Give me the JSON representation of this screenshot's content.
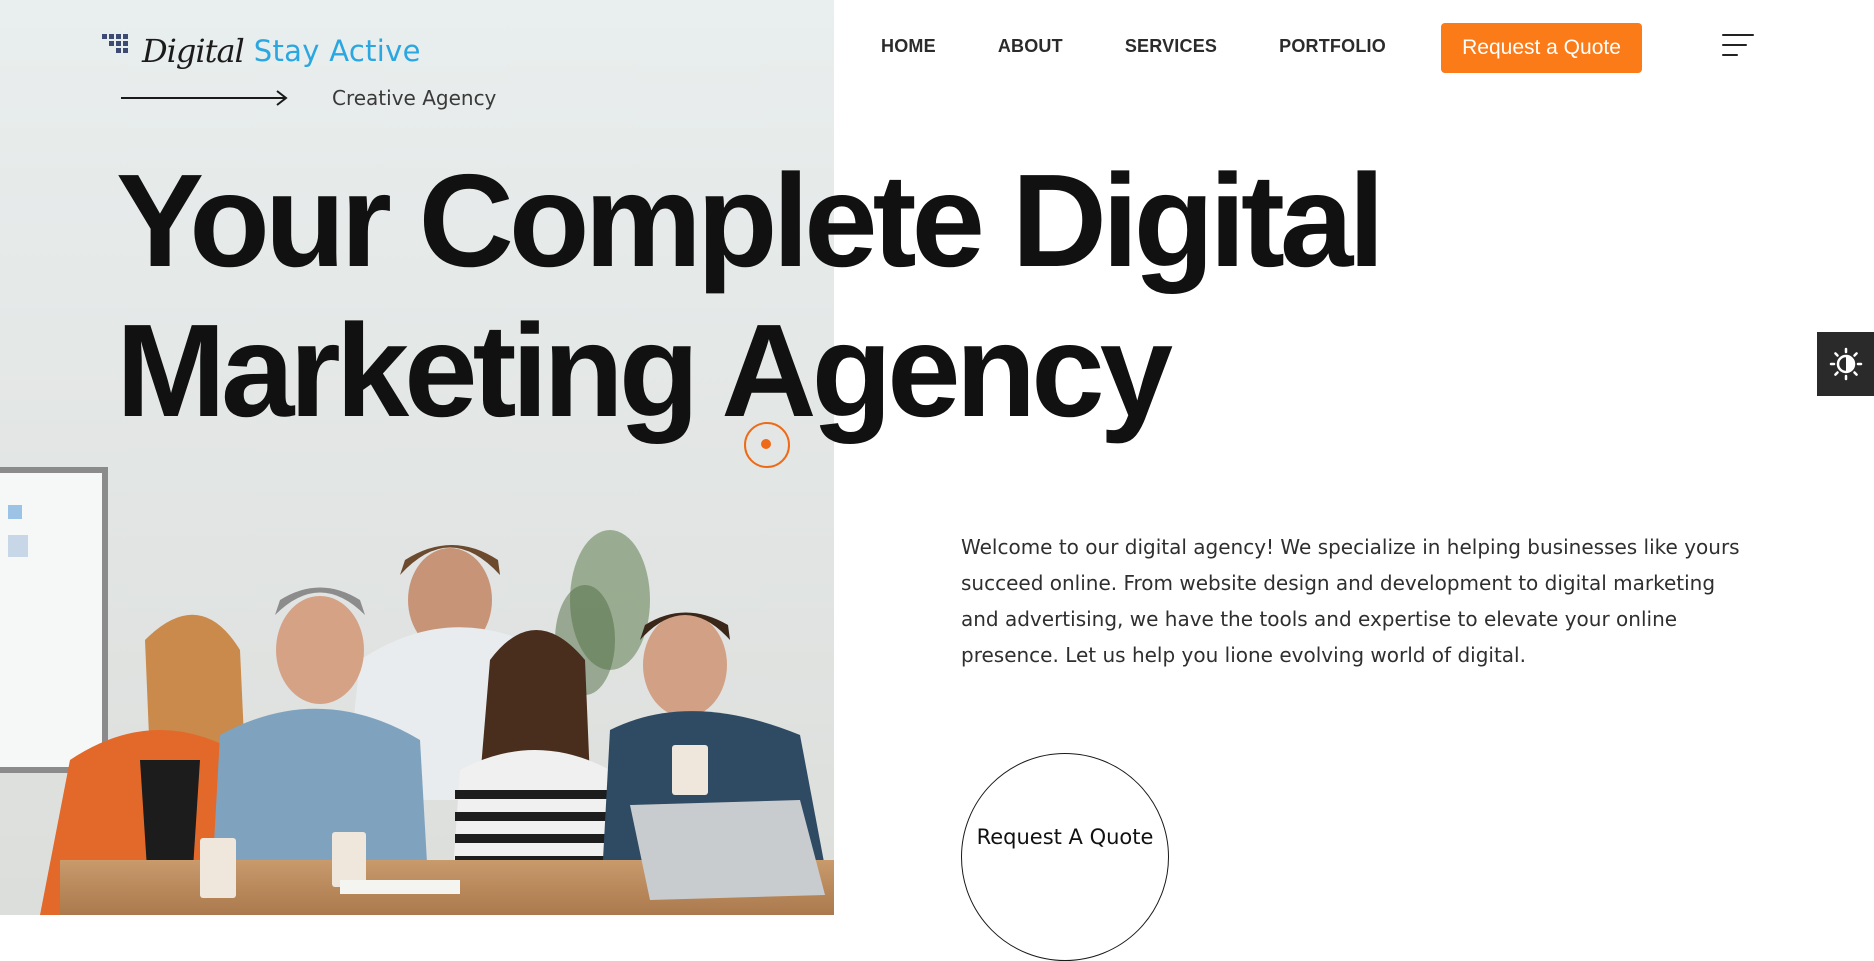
{
  "header": {
    "logo": {
      "word_one": "Digital",
      "word_two": "Stay Active",
      "brand_color": "#2aa6e0"
    },
    "nav": [
      {
        "label": "HOME"
      },
      {
        "label": "ABOUT"
      },
      {
        "label": "SERVICES"
      },
      {
        "label": "PORTFOLIO"
      }
    ],
    "cta_label": "Request a Quote",
    "cta_color": "#fb7b18",
    "menu_icon": "hamburger-menu-icon"
  },
  "hero": {
    "tagline": "Creative Agency",
    "headline_line1": "Your Complete Digital",
    "headline_line2": "Marketing Agency",
    "intro": "Welcome to our digital agency! We specialize in helping businesses like yours succeed online. From website design and development to digital marketing and advertising, we have the tools and expertise to elevate your online presence. Let us help you lione evolving world of digital.",
    "circle_cta_label": "Request A Quote",
    "accent_color": "#ee6a16"
  },
  "theme_toggle": {
    "icon": "sun-contrast-icon"
  }
}
